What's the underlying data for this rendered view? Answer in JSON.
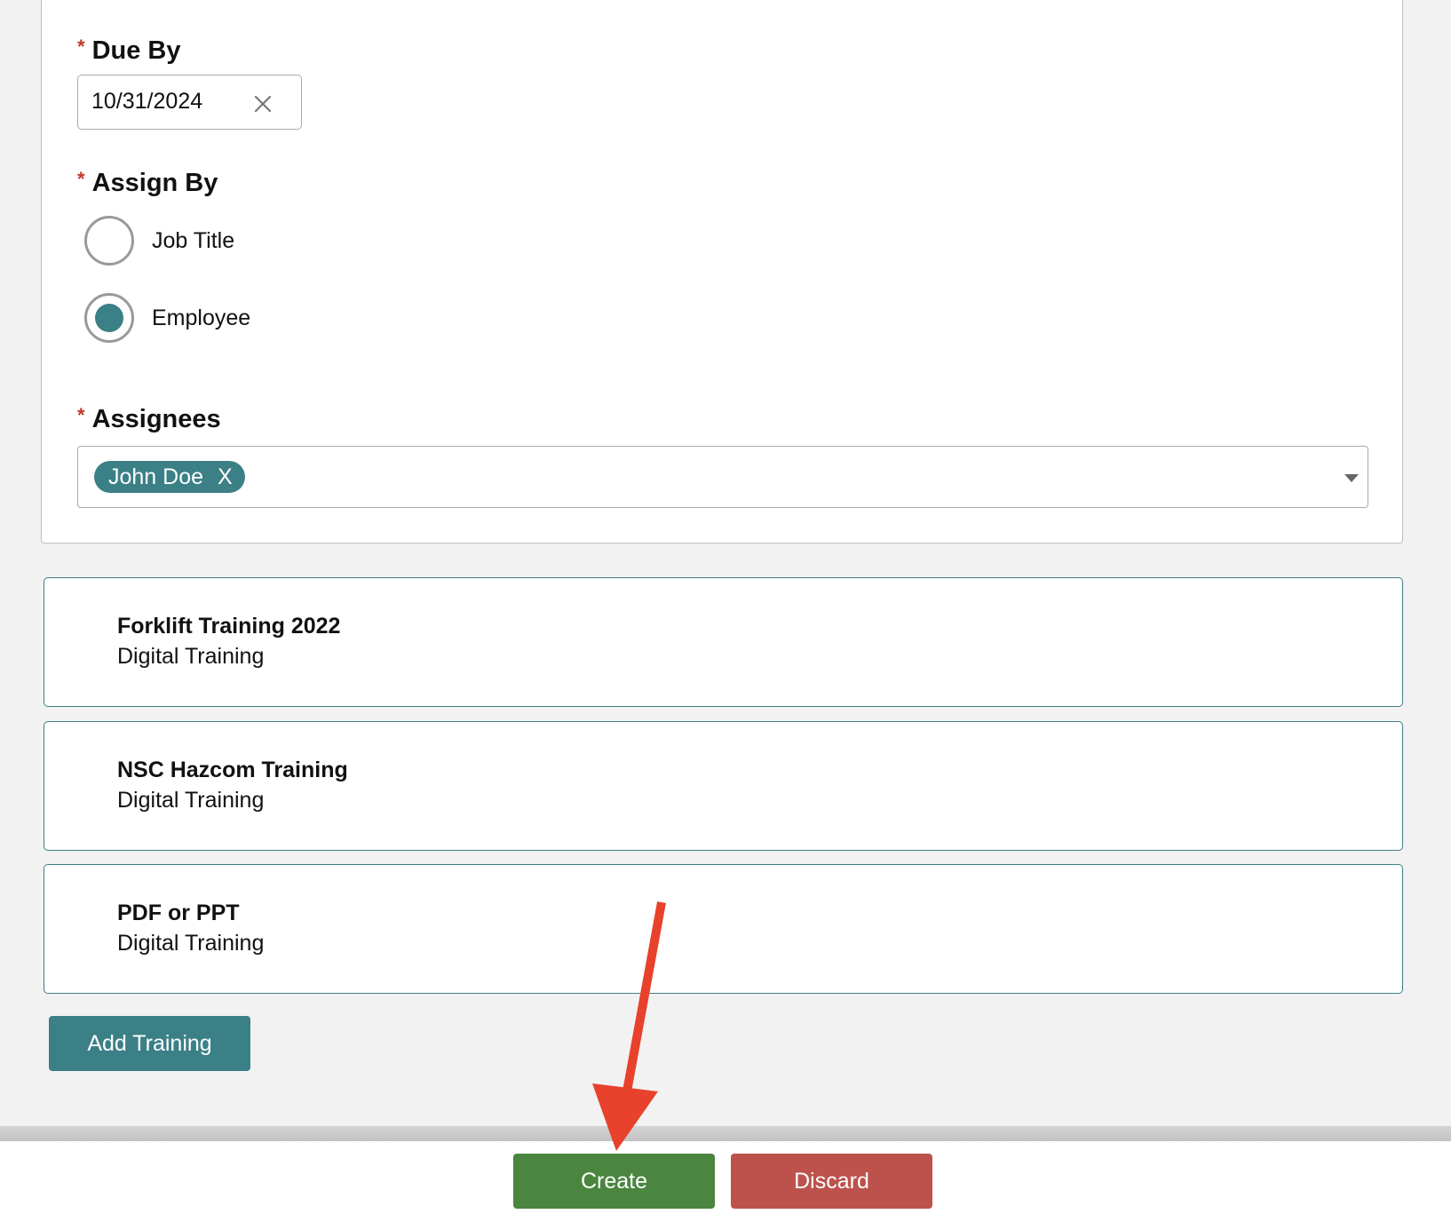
{
  "form": {
    "due_by": {
      "label": "Due By",
      "required_mark": "*",
      "value": "10/31/2024"
    },
    "assign_by": {
      "label": "Assign By",
      "required_mark": "*",
      "options": [
        {
          "label": "Job Title",
          "selected": false
        },
        {
          "label": "Employee",
          "selected": true
        }
      ]
    },
    "assignees": {
      "label": "Assignees",
      "required_mark": "*",
      "chips": [
        {
          "label": "John Doe",
          "remove": "X"
        }
      ]
    }
  },
  "trainings": [
    {
      "title": "Forklift Training 2022",
      "type": "Digital Training"
    },
    {
      "title": "NSC Hazcom Training",
      "type": "Digital Training"
    },
    {
      "title": "PDF or PPT",
      "type": "Digital Training"
    }
  ],
  "actions": {
    "add_training": "Add Training",
    "create": "Create",
    "discard": "Discard"
  },
  "colors": {
    "accent": "#3b8086",
    "create": "#4a8640",
    "discard": "#bd524c",
    "required": "#c0392b",
    "annotation_arrow": "#e8412c"
  },
  "icons": {
    "clear": "close-icon",
    "dropdown": "chevron-down-icon",
    "annotation": "arrow-icon"
  }
}
